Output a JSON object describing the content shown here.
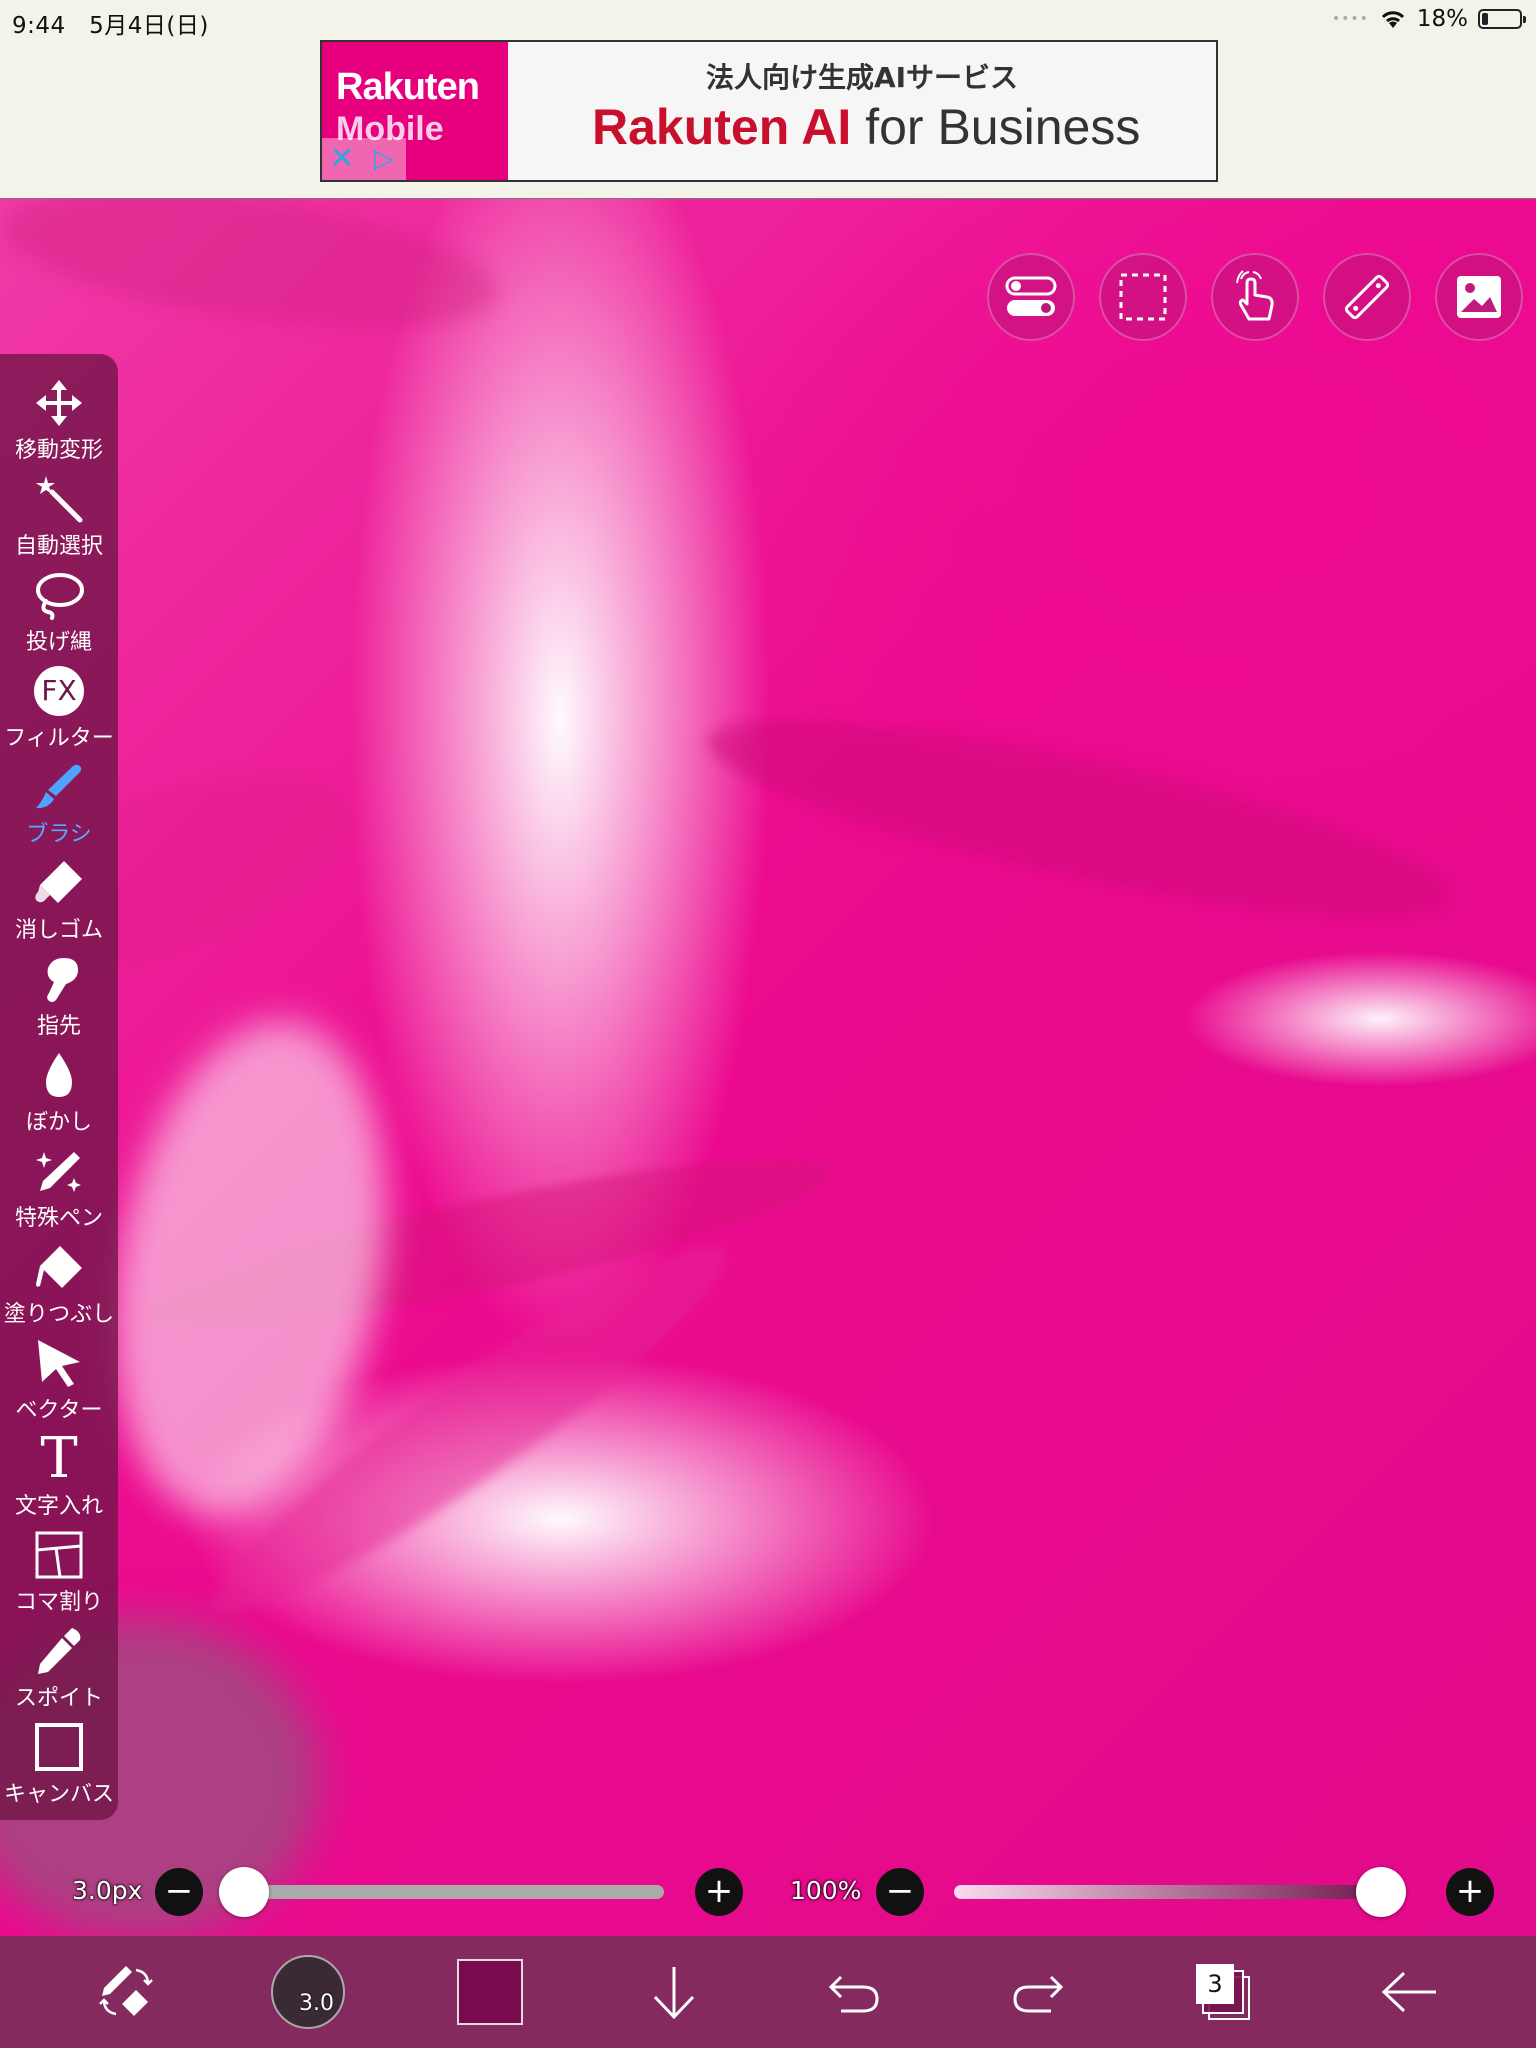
{
  "status_bar": {
    "time": "9:44",
    "date": "5月4日(日)",
    "battery": "18%",
    "battery_level": 0.18
  },
  "ad": {
    "brand_line1": "Rakuten",
    "brand_line2": "Mobile",
    "subtitle": "法人向け生成AIサービス",
    "headline": "Rakuten AI",
    "headline_suffix": "for Business",
    "close_icon": "close-icon",
    "info_icon": "adchoices-icon"
  },
  "top_tools": [
    {
      "name": "toggle-settings",
      "icon": "toggle-icon"
    },
    {
      "name": "selection",
      "icon": "dashed-rectangle-icon"
    },
    {
      "name": "touch-gesture",
      "icon": "hand-pointer-icon"
    },
    {
      "name": "ruler",
      "icon": "ruler-icon"
    },
    {
      "name": "material",
      "icon": "image-icon"
    }
  ],
  "tools": [
    {
      "label": "移動変形",
      "icon": "move-arrows-icon"
    },
    {
      "label": "自動選択",
      "icon": "magic-wand-icon"
    },
    {
      "label": "投げ縄",
      "icon": "lasso-icon"
    },
    {
      "label": "フィルター",
      "icon": "fx-icon",
      "icon_text": "FX"
    },
    {
      "label": "ブラシ",
      "icon": "brush-icon",
      "active": true
    },
    {
      "label": "消しゴム",
      "icon": "eraser-icon"
    },
    {
      "label": "指先",
      "icon": "finger-smudge-icon"
    },
    {
      "label": "ぼかし",
      "icon": "drop-blur-icon"
    },
    {
      "label": "特殊ペン",
      "icon": "sparkle-pen-icon"
    },
    {
      "label": "塗りつぶし",
      "icon": "fill-bucket-icon"
    },
    {
      "label": "ベクター",
      "icon": "vector-arrow-icon"
    },
    {
      "label": "文字入れ",
      "icon": "text-icon",
      "icon_text": "T"
    },
    {
      "label": "コマ割り",
      "icon": "panel-layout-icon"
    },
    {
      "label": "スポイト",
      "icon": "eyedropper-icon"
    },
    {
      "label": "キャンバス",
      "icon": "canvas-icon"
    }
  ],
  "brush_size": {
    "value": "3.0px",
    "level": 0.02,
    "minus": "−",
    "plus": "+"
  },
  "opacity": {
    "value": "100%",
    "level": 1.0,
    "minus": "−",
    "plus": "+"
  },
  "bottom": {
    "brush_preview_size": "3.0",
    "current_color": "#7a0a4e",
    "layer_count": "3"
  }
}
